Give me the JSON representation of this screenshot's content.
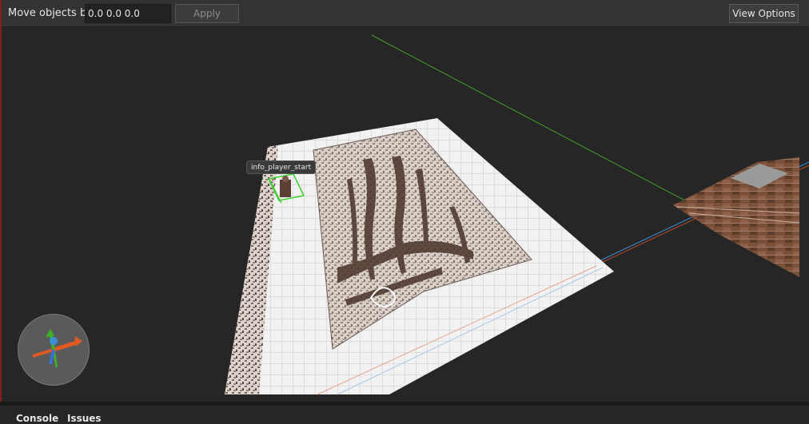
{
  "toolbar": {
    "move_label": "Move objects by",
    "move_value": "0.0 0.0 0.0",
    "apply_label": "Apply",
    "view_options_label": "View Options"
  },
  "viewport": {
    "entity_label": "info_player_start"
  },
  "dock": {
    "tabs": [
      "Console",
      "Issues"
    ]
  },
  "colors": {
    "toolbar_bg": "#333333",
    "viewport_bg": "#262626",
    "axis_x": "#d85a2a",
    "axis_y": "#3fae2a",
    "axis_z": "#3a8fd8",
    "selection": "#3bd12f"
  },
  "icons": [
    "orientation-gizmo-icon"
  ]
}
